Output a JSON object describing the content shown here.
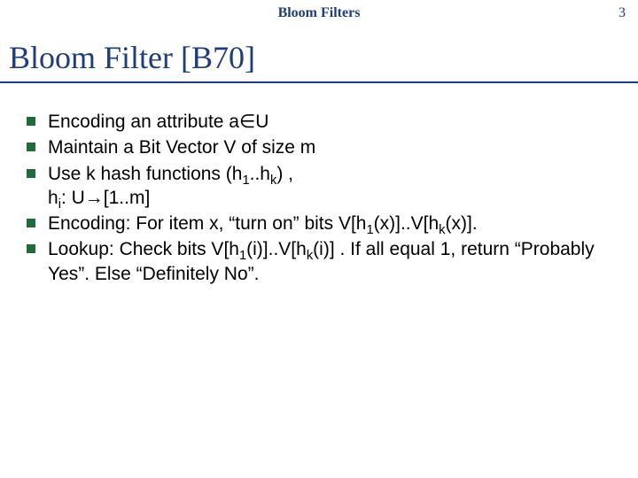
{
  "header": {
    "title": "Bloom Filters",
    "page_number": "3"
  },
  "slide_title": "Bloom Filter [B70]",
  "bullets": [
    {
      "html": "Encoding an attribute a&isin;U"
    },
    {
      "html": "Maintain a Bit Vector V of size m"
    },
    {
      "html": "Use k hash functions (h<sub>1</sub>..h<sub>k</sub>) ,<br>h<sub>i</sub>: U&rarr;[1..m]"
    },
    {
      "html": "Encoding: For item x, &ldquo;turn on&rdquo; bits V[h<sub>1</sub>(x)]..V[h<sub>k</sub>(x)]."
    },
    {
      "html": "Lookup: Check bits V[h<sub>1</sub>(i)]..V[h<sub>k</sub>(i)] . If all equal 1, return &ldquo;Probably Yes&rdquo;. Else &ldquo;Definitely No&rdquo;."
    }
  ]
}
